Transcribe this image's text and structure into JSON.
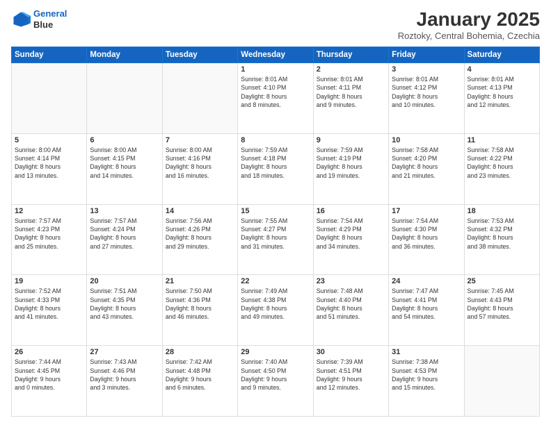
{
  "logo": {
    "line1": "General",
    "line2": "Blue"
  },
  "title": "January 2025",
  "subtitle": "Roztoky, Central Bohemia, Czechia",
  "weekdays": [
    "Sunday",
    "Monday",
    "Tuesday",
    "Wednesday",
    "Thursday",
    "Friday",
    "Saturday"
  ],
  "weeks": [
    [
      {
        "day": "",
        "content": ""
      },
      {
        "day": "",
        "content": ""
      },
      {
        "day": "",
        "content": ""
      },
      {
        "day": "1",
        "content": "Sunrise: 8:01 AM\nSunset: 4:10 PM\nDaylight: 8 hours\nand 8 minutes."
      },
      {
        "day": "2",
        "content": "Sunrise: 8:01 AM\nSunset: 4:11 PM\nDaylight: 8 hours\nand 9 minutes."
      },
      {
        "day": "3",
        "content": "Sunrise: 8:01 AM\nSunset: 4:12 PM\nDaylight: 8 hours\nand 10 minutes."
      },
      {
        "day": "4",
        "content": "Sunrise: 8:01 AM\nSunset: 4:13 PM\nDaylight: 8 hours\nand 12 minutes."
      }
    ],
    [
      {
        "day": "5",
        "content": "Sunrise: 8:00 AM\nSunset: 4:14 PM\nDaylight: 8 hours\nand 13 minutes."
      },
      {
        "day": "6",
        "content": "Sunrise: 8:00 AM\nSunset: 4:15 PM\nDaylight: 8 hours\nand 14 minutes."
      },
      {
        "day": "7",
        "content": "Sunrise: 8:00 AM\nSunset: 4:16 PM\nDaylight: 8 hours\nand 16 minutes."
      },
      {
        "day": "8",
        "content": "Sunrise: 7:59 AM\nSunset: 4:18 PM\nDaylight: 8 hours\nand 18 minutes."
      },
      {
        "day": "9",
        "content": "Sunrise: 7:59 AM\nSunset: 4:19 PM\nDaylight: 8 hours\nand 19 minutes."
      },
      {
        "day": "10",
        "content": "Sunrise: 7:58 AM\nSunset: 4:20 PM\nDaylight: 8 hours\nand 21 minutes."
      },
      {
        "day": "11",
        "content": "Sunrise: 7:58 AM\nSunset: 4:22 PM\nDaylight: 8 hours\nand 23 minutes."
      }
    ],
    [
      {
        "day": "12",
        "content": "Sunrise: 7:57 AM\nSunset: 4:23 PM\nDaylight: 8 hours\nand 25 minutes."
      },
      {
        "day": "13",
        "content": "Sunrise: 7:57 AM\nSunset: 4:24 PM\nDaylight: 8 hours\nand 27 minutes."
      },
      {
        "day": "14",
        "content": "Sunrise: 7:56 AM\nSunset: 4:26 PM\nDaylight: 8 hours\nand 29 minutes."
      },
      {
        "day": "15",
        "content": "Sunrise: 7:55 AM\nSunset: 4:27 PM\nDaylight: 8 hours\nand 31 minutes."
      },
      {
        "day": "16",
        "content": "Sunrise: 7:54 AM\nSunset: 4:29 PM\nDaylight: 8 hours\nand 34 minutes."
      },
      {
        "day": "17",
        "content": "Sunrise: 7:54 AM\nSunset: 4:30 PM\nDaylight: 8 hours\nand 36 minutes."
      },
      {
        "day": "18",
        "content": "Sunrise: 7:53 AM\nSunset: 4:32 PM\nDaylight: 8 hours\nand 38 minutes."
      }
    ],
    [
      {
        "day": "19",
        "content": "Sunrise: 7:52 AM\nSunset: 4:33 PM\nDaylight: 8 hours\nand 41 minutes."
      },
      {
        "day": "20",
        "content": "Sunrise: 7:51 AM\nSunset: 4:35 PM\nDaylight: 8 hours\nand 43 minutes."
      },
      {
        "day": "21",
        "content": "Sunrise: 7:50 AM\nSunset: 4:36 PM\nDaylight: 8 hours\nand 46 minutes."
      },
      {
        "day": "22",
        "content": "Sunrise: 7:49 AM\nSunset: 4:38 PM\nDaylight: 8 hours\nand 49 minutes."
      },
      {
        "day": "23",
        "content": "Sunrise: 7:48 AM\nSunset: 4:40 PM\nDaylight: 8 hours\nand 51 minutes."
      },
      {
        "day": "24",
        "content": "Sunrise: 7:47 AM\nSunset: 4:41 PM\nDaylight: 8 hours\nand 54 minutes."
      },
      {
        "day": "25",
        "content": "Sunrise: 7:45 AM\nSunset: 4:43 PM\nDaylight: 8 hours\nand 57 minutes."
      }
    ],
    [
      {
        "day": "26",
        "content": "Sunrise: 7:44 AM\nSunset: 4:45 PM\nDaylight: 9 hours\nand 0 minutes."
      },
      {
        "day": "27",
        "content": "Sunrise: 7:43 AM\nSunset: 4:46 PM\nDaylight: 9 hours\nand 3 minutes."
      },
      {
        "day": "28",
        "content": "Sunrise: 7:42 AM\nSunset: 4:48 PM\nDaylight: 9 hours\nand 6 minutes."
      },
      {
        "day": "29",
        "content": "Sunrise: 7:40 AM\nSunset: 4:50 PM\nDaylight: 9 hours\nand 9 minutes."
      },
      {
        "day": "30",
        "content": "Sunrise: 7:39 AM\nSunset: 4:51 PM\nDaylight: 9 hours\nand 12 minutes."
      },
      {
        "day": "31",
        "content": "Sunrise: 7:38 AM\nSunset: 4:53 PM\nDaylight: 9 hours\nand 15 minutes."
      },
      {
        "day": "",
        "content": ""
      }
    ]
  ]
}
